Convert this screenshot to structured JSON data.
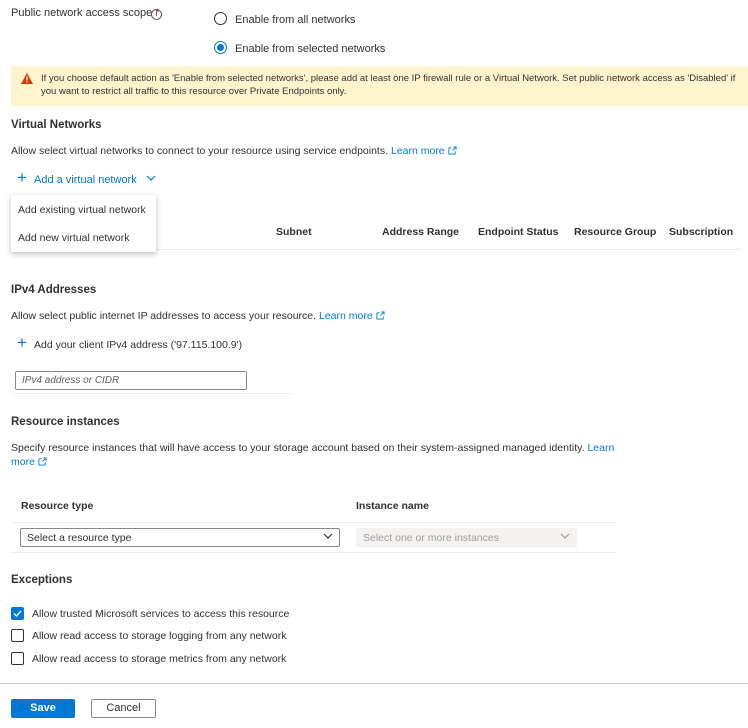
{
  "network_access": {
    "label": "Public network access scope",
    "required_mark": "*",
    "info_glyph": "i",
    "options": [
      {
        "label": "Enable from all networks",
        "selected": false
      },
      {
        "label": "Enable from selected networks",
        "selected": true
      }
    ]
  },
  "warning": {
    "icon": "warning-icon",
    "color": "#fff4ce",
    "text": "If you choose default action as 'Enable from selected networks', please add at least one IP firewall rule or a Virtual Network. Set public network access as 'Disabled' if you want to restrict all traffic to this resource over Private Endpoints only."
  },
  "virtual_networks": {
    "title": "Virtual Networks",
    "description": "Allow select virtual networks to connect to your resource using service endpoints.",
    "learn_more": "Learn more",
    "add_button": "Add a virtual network",
    "menu": [
      "Add existing virtual network",
      "Add new virtual network"
    ],
    "columns": [
      "Subnet",
      "Address Range",
      "Endpoint Status",
      "Resource Group",
      "Subscription"
    ]
  },
  "ipv4": {
    "title": "IPv4 Addresses",
    "description": "Allow select public internet IP addresses to access your resource.",
    "learn_more": "Learn more",
    "add_client": "Add your client IPv4 address ('97.115.100.9')",
    "placeholder": "IPv4 address or CIDR"
  },
  "resource_instances": {
    "title": "Resource instances",
    "description": "Specify resource instances that will have access to your storage account based on their system-assigned managed identity.",
    "learn_more_1": "Learn",
    "learn_more_2": "more",
    "col_resource_type": "Resource type",
    "col_instance_name": "Instance name",
    "resource_type_value": "Select a resource type",
    "instance_value": "Select one or more instances"
  },
  "exceptions": {
    "title": "Exceptions",
    "items": [
      {
        "label": "Allow trusted Microsoft services to access this resource",
        "checked": true
      },
      {
        "label": "Allow read access to storage logging from any network",
        "checked": false
      },
      {
        "label": "Allow read access to storage metrics from any network",
        "checked": false
      }
    ]
  },
  "footer": {
    "save": "Save",
    "cancel": "Cancel"
  },
  "colors": {
    "accent": "#0078d4",
    "warning_bg": "#fff4ce",
    "warning_icon": "#d83b01",
    "required": "#a4262c"
  }
}
